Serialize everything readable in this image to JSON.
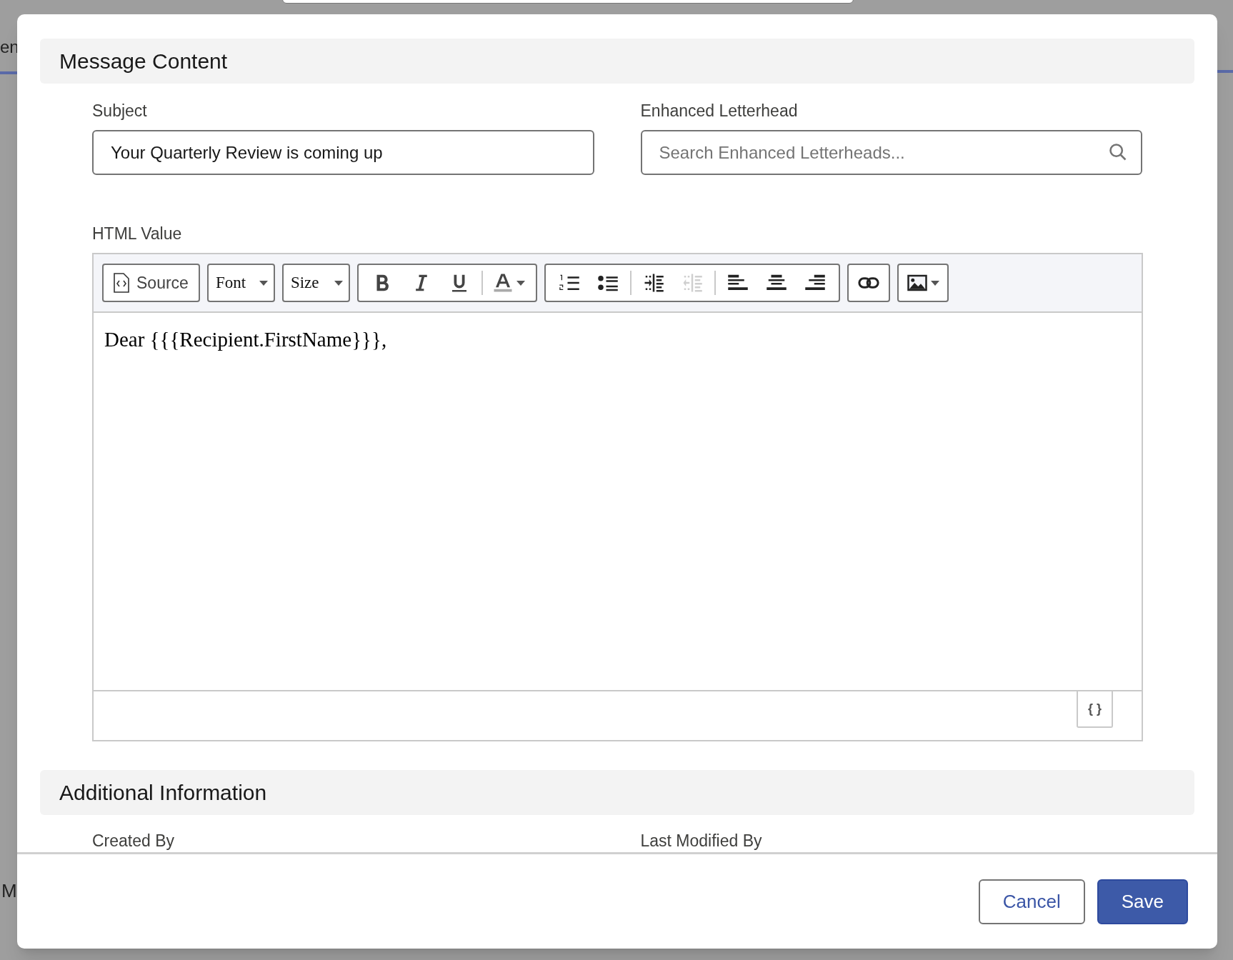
{
  "background": {
    "fragments": [
      {
        "text": "en"
      },
      {
        "text": "M"
      }
    ]
  },
  "modal": {
    "sections": [
      {
        "title": "Message Content"
      },
      {
        "title": "Additional Information"
      }
    ],
    "subject": {
      "label": "Subject",
      "value": "Your Quarterly Review is coming up"
    },
    "letterhead": {
      "label": "Enhanced Letterhead",
      "placeholder": "Search Enhanced Letterheads..."
    },
    "html_value": {
      "label": "HTML Value",
      "toolbar": [
        {
          "kind": "source",
          "label": "Source"
        },
        {
          "kind": "dropdown",
          "label": "Font"
        },
        {
          "kind": "dropdown",
          "label": "Size"
        },
        {
          "kind": "group",
          "items": [
            {
              "kind": "bold",
              "disabled": false
            },
            {
              "kind": "italic",
              "disabled": false
            },
            {
              "kind": "underline",
              "disabled": false
            },
            {
              "kind": "separator"
            },
            {
              "kind": "text_color",
              "disabled": false
            }
          ]
        },
        {
          "kind": "group",
          "items": [
            {
              "kind": "numbered_list",
              "disabled": false
            },
            {
              "kind": "bulleted_list",
              "disabled": false
            },
            {
              "kind": "separator"
            },
            {
              "kind": "indent",
              "disabled": false
            },
            {
              "kind": "outdent",
              "disabled": true
            },
            {
              "kind": "separator"
            },
            {
              "kind": "align_left",
              "disabled": false
            },
            {
              "kind": "align_center",
              "disabled": false
            },
            {
              "kind": "align_right",
              "disabled": false
            }
          ]
        },
        {
          "kind": "group",
          "items": [
            {
              "kind": "link",
              "disabled": false
            }
          ]
        },
        {
          "kind": "group",
          "items": [
            {
              "kind": "image",
              "disabled": false
            }
          ]
        }
      ],
      "content": "Dear {{{Recipient.FirstName}}},",
      "merge_button": "{ }"
    },
    "fields": [
      {
        "label": "Created By"
      },
      {
        "label": "Last Modified By"
      }
    ],
    "buttons": [
      {
        "label": "Cancel",
        "kind": "secondary"
      },
      {
        "label": "Save",
        "kind": "primary"
      }
    ]
  }
}
